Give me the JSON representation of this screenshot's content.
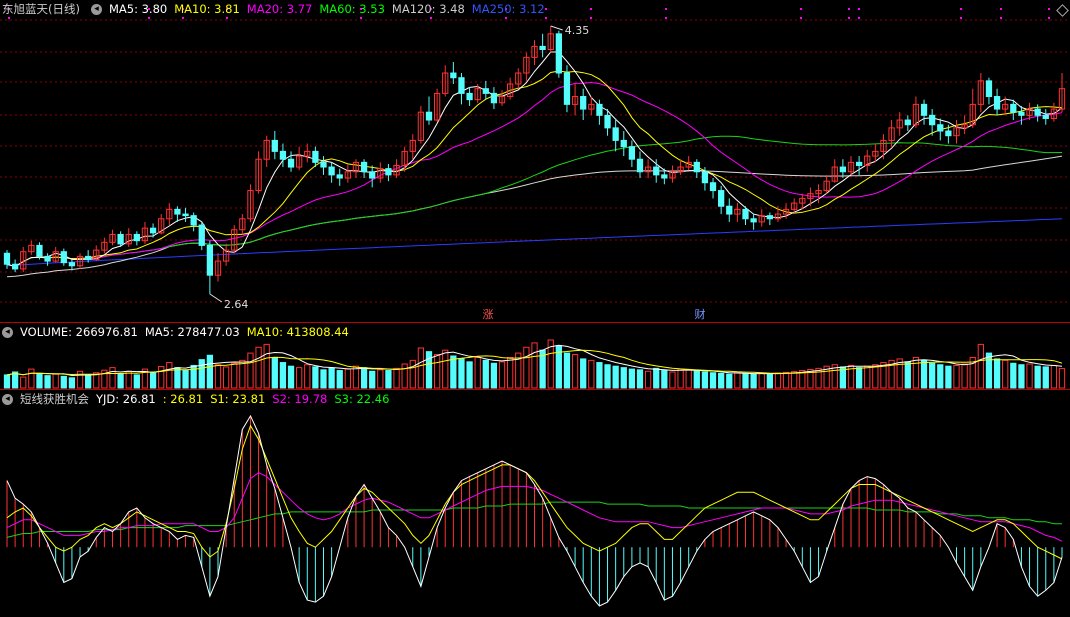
{
  "main_pane": {
    "title": "东旭蓝天(日线)",
    "indicators": [
      {
        "label": "MA5: 3.80",
        "color": "#ffffff"
      },
      {
        "label": "MA10: 3.81",
        "color": "#ffff00"
      },
      {
        "label": "MA20: 3.77",
        "color": "#ff00ff"
      },
      {
        "label": "MA60: 3.53",
        "color": "#00ff00"
      },
      {
        "label": "MA120: 3.48",
        "color": "#cccccc"
      },
      {
        "label": "MA250: 3.12",
        "color": "#3355ff"
      }
    ],
    "high_label": "4.35",
    "low_label": "2.64",
    "markers": [
      "涨",
      "财"
    ]
  },
  "volume_pane": {
    "indicators": [
      {
        "label": "VOLUME: 266976.81",
        "color": "#ffffff"
      },
      {
        "label": "MA5: 278477.03",
        "color": "#ffffff"
      },
      {
        "label": "MA10: 413808.44",
        "color": "#ffff00"
      }
    ]
  },
  "indicator_pane": {
    "title": "短线获胜机会",
    "indicators": [
      {
        "label": "YJD: 26.81",
        "color": "#ffffff"
      },
      {
        "label": ": 26.81",
        "color": "#ffff00"
      },
      {
        "label": "S1: 23.81",
        "color": "#ffff00"
      },
      {
        "label": "S2: 19.78",
        "color": "#ff00ff"
      },
      {
        "label": "S3: 22.46",
        "color": "#00ff00"
      }
    ]
  },
  "colors": {
    "up": "#ff3232",
    "down": "#54fcfc",
    "grid": "#8b0000",
    "separator": "#c00000"
  },
  "chart_data": {
    "type": "candlestick",
    "title": "东旭蓝天(日线)",
    "y_high": 4.35,
    "y_low": 2.64,
    "candles": [
      [
        2.9,
        2.83,
        2.92,
        2.8
      ],
      [
        2.83,
        2.8,
        2.86,
        2.78
      ],
      [
        2.8,
        2.91,
        2.94,
        2.78
      ],
      [
        2.91,
        2.95,
        2.98,
        2.89
      ],
      [
        2.95,
        2.88,
        2.97,
        2.86
      ],
      [
        2.88,
        2.85,
        2.9,
        2.82
      ],
      [
        2.85,
        2.91,
        2.94,
        2.84
      ],
      [
        2.91,
        2.84,
        2.93,
        2.82
      ],
      [
        2.84,
        2.82,
        2.86,
        2.79
      ],
      [
        2.82,
        2.88,
        2.9,
        2.8
      ],
      [
        2.88,
        2.86,
        2.92,
        2.84
      ],
      [
        2.86,
        2.92,
        2.95,
        2.85
      ],
      [
        2.92,
        2.97,
        3.0,
        2.9
      ],
      [
        2.97,
        3.02,
        3.05,
        2.95
      ],
      [
        3.02,
        2.96,
        3.04,
        2.94
      ],
      [
        2.96,
        3.02,
        3.06,
        2.94
      ],
      [
        3.02,
        2.98,
        3.04,
        2.95
      ],
      [
        2.98,
        3.06,
        3.1,
        2.96
      ],
      [
        3.06,
        3.03,
        3.09,
        3.0
      ],
      [
        3.03,
        3.12,
        3.15,
        3.02
      ],
      [
        3.12,
        3.18,
        3.22,
        3.08
      ],
      [
        3.18,
        3.15,
        3.2,
        3.1
      ],
      [
        3.15,
        3.14,
        3.19,
        3.1
      ],
      [
        3.14,
        3.08,
        3.16,
        3.04
      ],
      [
        3.08,
        2.95,
        3.1,
        2.92
      ],
      [
        2.95,
        2.76,
        2.98,
        2.64
      ],
      [
        2.76,
        2.85,
        2.9,
        2.72
      ],
      [
        2.85,
        2.92,
        2.96,
        2.82
      ],
      [
        2.92,
        3.05,
        3.08,
        2.9
      ],
      [
        3.05,
        3.12,
        3.15,
        3.02
      ],
      [
        3.12,
        3.3,
        3.34,
        3.1
      ],
      [
        3.3,
        3.5,
        3.55,
        3.28
      ],
      [
        3.5,
        3.62,
        3.65,
        3.45
      ],
      [
        3.62,
        3.55,
        3.68,
        3.5
      ],
      [
        3.55,
        3.5,
        3.6,
        3.45
      ],
      [
        3.5,
        3.45,
        3.55,
        3.42
      ],
      [
        3.45,
        3.52,
        3.58,
        3.43
      ],
      [
        3.52,
        3.55,
        3.6,
        3.48
      ],
      [
        3.55,
        3.48,
        3.58,
        3.45
      ],
      [
        3.48,
        3.45,
        3.52,
        3.4
      ],
      [
        3.45,
        3.4,
        3.48,
        3.35
      ],
      [
        3.4,
        3.38,
        3.44,
        3.33
      ],
      [
        3.38,
        3.42,
        3.47,
        3.35
      ],
      [
        3.42,
        3.48,
        3.5,
        3.38
      ],
      [
        3.48,
        3.42,
        3.5,
        3.38
      ],
      [
        3.42,
        3.38,
        3.46,
        3.32
      ],
      [
        3.38,
        3.44,
        3.48,
        3.35
      ],
      [
        3.44,
        3.4,
        3.47,
        3.36
      ],
      [
        3.4,
        3.46,
        3.5,
        3.38
      ],
      [
        3.46,
        3.55,
        3.58,
        3.42
      ],
      [
        3.55,
        3.62,
        3.66,
        3.5
      ],
      [
        3.62,
        3.8,
        3.84,
        3.6
      ],
      [
        3.8,
        3.75,
        3.9,
        3.72
      ],
      [
        3.75,
        3.92,
        3.95,
        3.74
      ],
      [
        3.92,
        4.05,
        4.1,
        3.9
      ],
      [
        4.05,
        4.02,
        4.12,
        3.98
      ],
      [
        4.02,
        3.92,
        4.05,
        3.85
      ],
      [
        3.92,
        3.88,
        3.96,
        3.84
      ],
      [
        3.88,
        3.95,
        3.98,
        3.86
      ],
      [
        3.95,
        3.92,
        4.0,
        3.88
      ],
      [
        3.92,
        3.86,
        3.96,
        3.82
      ],
      [
        3.86,
        3.9,
        3.94,
        3.84
      ],
      [
        3.9,
        3.98,
        4.02,
        3.88
      ],
      [
        3.98,
        4.05,
        4.08,
        3.95
      ],
      [
        4.05,
        4.15,
        4.18,
        4.0
      ],
      [
        4.15,
        4.22,
        4.26,
        4.1
      ],
      [
        4.22,
        4.2,
        4.3,
        4.15
      ],
      [
        4.2,
        4.3,
        4.35,
        4.18
      ],
      [
        4.3,
        4.05,
        4.32,
        4.02
      ],
      [
        4.05,
        3.85,
        4.1,
        3.8
      ],
      [
        3.85,
        3.9,
        3.98,
        3.78
      ],
      [
        3.9,
        3.82,
        3.95,
        3.75
      ],
      [
        3.82,
        3.85,
        3.9,
        3.78
      ],
      [
        3.85,
        3.78,
        3.88,
        3.72
      ],
      [
        3.78,
        3.7,
        3.82,
        3.65
      ],
      [
        3.7,
        3.62,
        3.76,
        3.55
      ],
      [
        3.62,
        3.58,
        3.68,
        3.52
      ],
      [
        3.58,
        3.5,
        3.62,
        3.45
      ],
      [
        3.5,
        3.42,
        3.55,
        3.38
      ],
      [
        3.42,
        3.45,
        3.5,
        3.38
      ],
      [
        3.45,
        3.4,
        3.5,
        3.35
      ],
      [
        3.4,
        3.38,
        3.44,
        3.34
      ],
      [
        3.38,
        3.42,
        3.46,
        3.35
      ],
      [
        3.42,
        3.45,
        3.5,
        3.4
      ],
      [
        3.45,
        3.48,
        3.52,
        3.43
      ],
      [
        3.48,
        3.42,
        3.5,
        3.38
      ],
      [
        3.42,
        3.35,
        3.45,
        3.3
      ],
      [
        3.35,
        3.3,
        3.38,
        3.25
      ],
      [
        3.3,
        3.2,
        3.33,
        3.15
      ],
      [
        3.2,
        3.15,
        3.25,
        3.1
      ],
      [
        3.15,
        3.18,
        3.22,
        3.1
      ],
      [
        3.18,
        3.12,
        3.2,
        3.08
      ],
      [
        3.12,
        3.1,
        3.15,
        3.05
      ],
      [
        3.1,
        3.14,
        3.18,
        3.07
      ],
      [
        3.14,
        3.12,
        3.16,
        3.08
      ],
      [
        3.12,
        3.15,
        3.2,
        3.1
      ],
      [
        3.15,
        3.18,
        3.22,
        3.12
      ],
      [
        3.18,
        3.22,
        3.25,
        3.15
      ],
      [
        3.22,
        3.25,
        3.28,
        3.18
      ],
      [
        3.25,
        3.28,
        3.32,
        3.2
      ],
      [
        3.28,
        3.3,
        3.34,
        3.22
      ],
      [
        3.3,
        3.36,
        3.4,
        3.28
      ],
      [
        3.36,
        3.45,
        3.5,
        3.35
      ],
      [
        3.45,
        3.42,
        3.5,
        3.38
      ],
      [
        3.42,
        3.48,
        3.52,
        3.4
      ],
      [
        3.48,
        3.46,
        3.52,
        3.4
      ],
      [
        3.46,
        3.52,
        3.56,
        3.42
      ],
      [
        3.52,
        3.55,
        3.6,
        3.48
      ],
      [
        3.55,
        3.62,
        3.66,
        3.5
      ],
      [
        3.62,
        3.7,
        3.75,
        3.58
      ],
      [
        3.7,
        3.75,
        3.8,
        3.65
      ],
      [
        3.75,
        3.72,
        3.78,
        3.68
      ],
      [
        3.72,
        3.85,
        3.9,
        3.7
      ],
      [
        3.85,
        3.78,
        3.88,
        3.72
      ],
      [
        3.78,
        3.72,
        3.82,
        3.65
      ],
      [
        3.72,
        3.68,
        3.76,
        3.62
      ],
      [
        3.68,
        3.65,
        3.72,
        3.6
      ],
      [
        3.65,
        3.7,
        3.75,
        3.6
      ],
      [
        3.7,
        3.72,
        3.78,
        3.66
      ],
      [
        3.72,
        3.85,
        3.95,
        3.7
      ],
      [
        3.85,
        4.0,
        4.05,
        3.8
      ],
      [
        4.0,
        3.9,
        4.02,
        3.85
      ],
      [
        3.9,
        3.82,
        3.95,
        3.78
      ],
      [
        3.82,
        3.85,
        3.9,
        3.78
      ],
      [
        3.85,
        3.8,
        3.88,
        3.75
      ],
      [
        3.8,
        3.78,
        3.84,
        3.72
      ],
      [
        3.78,
        3.82,
        3.86,
        3.75
      ],
      [
        3.82,
        3.78,
        3.85,
        3.74
      ],
      [
        3.78,
        3.76,
        3.82,
        3.72
      ],
      [
        3.76,
        3.82,
        3.86,
        3.74
      ],
      [
        3.82,
        3.95,
        4.05,
        3.8
      ]
    ],
    "volume": [
      180000,
      220000,
      150000,
      260000,
      200000,
      170000,
      190000,
      160000,
      140000,
      230000,
      175000,
      210000,
      245000,
      280000,
      190000,
      230000,
      180000,
      260000,
      205000,
      295000,
      350000,
      280000,
      240000,
      310000,
      390000,
      450000,
      320000,
      290000,
      340000,
      380000,
      480000,
      560000,
      600000,
      420000,
      350000,
      300000,
      280000,
      320000,
      290000,
      250000,
      270000,
      240000,
      260000,
      300000,
      280000,
      230000,
      250000,
      240000,
      270000,
      330000,
      380000,
      550000,
      500000,
      460000,
      520000,
      440000,
      400000,
      360000,
      420000,
      380000,
      340000,
      360000,
      420000,
      480000,
      560000,
      620000,
      520000,
      660000,
      580000,
      480000,
      460000,
      400000,
      380000,
      350000,
      320000,
      300000,
      280000,
      260000,
      250000,
      230000,
      270000,
      240000,
      220000,
      260000,
      250000,
      230000,
      220000,
      210000,
      200000,
      190000,
      210000,
      200000,
      190000,
      200000,
      195000,
      205000,
      215000,
      225000,
      240000,
      255000,
      270000,
      300000,
      320000,
      290000,
      310000,
      280000,
      300000,
      320000,
      350000,
      380000,
      400000,
      360000,
      420000,
      380000,
      340000,
      320000,
      300000,
      310000,
      330000,
      420000,
      600000,
      480000,
      400000,
      380000,
      340000,
      320000,
      330000,
      300000,
      290000,
      310000,
      266976
    ],
    "yjd": [
      64,
      55,
      52,
      48,
      40,
      32,
      22,
      12,
      14,
      25,
      28,
      35,
      40,
      38,
      42,
      48,
      50,
      45,
      42,
      40,
      38,
      34,
      36,
      35,
      20,
      5,
      15,
      40,
      65,
      90,
      97,
      88,
      72,
      60,
      45,
      30,
      12,
      3,
      2,
      5,
      15,
      30,
      45,
      56,
      62,
      55,
      48,
      40,
      36,
      30,
      20,
      10,
      25,
      40,
      50,
      58,
      64,
      66,
      68,
      70,
      72,
      74,
      72,
      70,
      68,
      62,
      55,
      45,
      35,
      28,
      20,
      12,
      5,
      0,
      2,
      8,
      15,
      20,
      22,
      20,
      12,
      3,
      5,
      12,
      20,
      28,
      34,
      38,
      40,
      42,
      44,
      46,
      48,
      46,
      44,
      40,
      34,
      28,
      20,
      12,
      15,
      28,
      40,
      52,
      60,
      64,
      66,
      65,
      62,
      58,
      55,
      50,
      48,
      44,
      40,
      36,
      30,
      22,
      15,
      8,
      20,
      30,
      42,
      40,
      34,
      20,
      10,
      5,
      8,
      12,
      25
    ],
    "yjd_s1": [
      45,
      48,
      50,
      46,
      40,
      35,
      30,
      28,
      30,
      34,
      36,
      40,
      42,
      40,
      42,
      45,
      48,
      46,
      44,
      42,
      40,
      38,
      38,
      37,
      30,
      25,
      28,
      42,
      60,
      80,
      92,
      85,
      75,
      65,
      55,
      45,
      38,
      32,
      30,
      34,
      38,
      44,
      50,
      56,
      60,
      58,
      54,
      50,
      46,
      42,
      36,
      32,
      36,
      44,
      52,
      58,
      62,
      64,
      66,
      68,
      70,
      72,
      72,
      70,
      68,
      64,
      58,
      52,
      46,
      40,
      36,
      32,
      30,
      28,
      30,
      32,
      36,
      40,
      42,
      42,
      38,
      34,
      34,
      38,
      42,
      46,
      50,
      52,
      54,
      56,
      58,
      58,
      58,
      56,
      54,
      52,
      50,
      48,
      46,
      44,
      44,
      48,
      52,
      56,
      60,
      62,
      62,
      62,
      60,
      58,
      56,
      54,
      52,
      50,
      48,
      46,
      44,
      42,
      40,
      38,
      40,
      42,
      44,
      44,
      42,
      38,
      34,
      30,
      28,
      26,
      24
    ],
    "yjd_s2": [
      40,
      42,
      44,
      44,
      42,
      40,
      38,
      36,
      36,
      36,
      37,
      38,
      38,
      39,
      40,
      40,
      41,
      41,
      41,
      42,
      42,
      42,
      42,
      42,
      40,
      38,
      38,
      40,
      45,
      55,
      65,
      68,
      66,
      62,
      58,
      54,
      50,
      47,
      45,
      44,
      45,
      47,
      50,
      52,
      54,
      55,
      54,
      53,
      51,
      49,
      47,
      45,
      45,
      47,
      49,
      51,
      53,
      55,
      57,
      59,
      60,
      61,
      61,
      61,
      61,
      60,
      59,
      57,
      55,
      53,
      51,
      49,
      47,
      45,
      44,
      43,
      43,
      43,
      43,
      43,
      42,
      41,
      40,
      40,
      41,
      42,
      43,
      44,
      45,
      46,
      47,
      48,
      49,
      50,
      50,
      50,
      50,
      49,
      48,
      47,
      47,
      47,
      48,
      49,
      51,
      52,
      53,
      54,
      54,
      54,
      53,
      52,
      51,
      50,
      49,
      48,
      47,
      46,
      45,
      44,
      43,
      43,
      43,
      43,
      42,
      41,
      40,
      38,
      36,
      35,
      33
    ],
    "yjd_s3": [
      35,
      36,
      37,
      37,
      38,
      38,
      38,
      38,
      38,
      38,
      38,
      39,
      39,
      39,
      39,
      40,
      40,
      40,
      40,
      40,
      40,
      40,
      41,
      41,
      41,
      41,
      41,
      41,
      42,
      43,
      44,
      45,
      46,
      47,
      47,
      48,
      48,
      48,
      48,
      48,
      48,
      48,
      48,
      48,
      48,
      49,
      49,
      49,
      49,
      49,
      49,
      49,
      49,
      49,
      49,
      50,
      50,
      50,
      50,
      51,
      51,
      51,
      52,
      52,
      52,
      52,
      52,
      53,
      53,
      53,
      53,
      53,
      53,
      53,
      52,
      52,
      52,
      52,
      52,
      51,
      51,
      51,
      51,
      51,
      50,
      50,
      50,
      50,
      50,
      50,
      50,
      50,
      50,
      50,
      50,
      50,
      50,
      50,
      50,
      50,
      50,
      50,
      50,
      50,
      50,
      50,
      50,
      49,
      49,
      49,
      49,
      48,
      48,
      48,
      48,
      47,
      47,
      47,
      46,
      46,
      46,
      45,
      45,
      45,
      44,
      44,
      44,
      43,
      43,
      42,
      42
    ]
  }
}
